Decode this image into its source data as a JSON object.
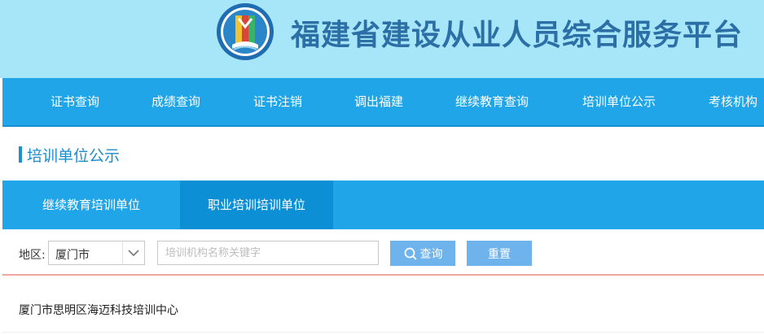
{
  "header": {
    "site_title": "福建省建设从业人员综合服务平台",
    "logo_icon": "fujian-construction-logo-icon"
  },
  "nav": {
    "items": [
      {
        "label": "证书查询"
      },
      {
        "label": "成绩查询"
      },
      {
        "label": "证书注销"
      },
      {
        "label": "调出福建"
      },
      {
        "label": "继续教育查询"
      },
      {
        "label": "培训单位公示"
      },
      {
        "label": "考核机构"
      }
    ]
  },
  "section": {
    "title": "培训单位公示"
  },
  "tabs": [
    {
      "label": "继续教育培训单位",
      "active": false
    },
    {
      "label": "职业培训培训单位",
      "active": true
    }
  ],
  "filter": {
    "region_label": "地区:",
    "region_value": "厦门市",
    "search_placeholder": "培训机构名称关键字",
    "search_value": "",
    "query_button": "查询",
    "reset_button": "重置"
  },
  "results": {
    "items": [
      {
        "name": "厦门市思明区海迈科技培训中心"
      }
    ]
  },
  "colors": {
    "header_bg": "#a6e6f8",
    "nav_bg": "#20a6e8",
    "active_tab": "#0d8fd6",
    "title_text": "#2b6fa6",
    "button_bg": "#6fb3ec",
    "divider": "#f0a7a0"
  }
}
